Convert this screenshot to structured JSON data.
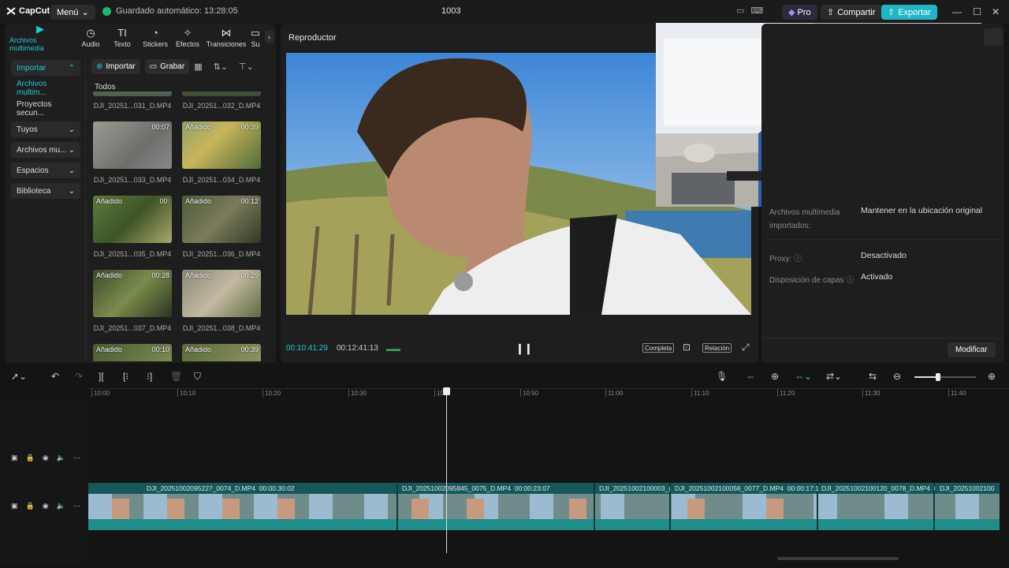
{
  "app": {
    "logo": "CapCut",
    "menu_label": "Menú",
    "autosave": "Guardado automático: 13:28:05",
    "project_title": "1003",
    "pro_label": "Pro",
    "share_label": "Compartir",
    "export_label": "Exportar"
  },
  "tabs": [
    {
      "label": "Archivos multimedia",
      "icon": "media-icon"
    },
    {
      "label": "Audio",
      "icon": "audio-icon"
    },
    {
      "label": "Texto",
      "icon": "text-icon"
    },
    {
      "label": "Stickers",
      "icon": "sticker-icon"
    },
    {
      "label": "Efectos",
      "icon": "effects-icon"
    },
    {
      "label": "Transiciones",
      "icon": "transition-icon"
    },
    {
      "label": "Su",
      "icon": "subtitle-icon"
    }
  ],
  "sidebar": {
    "items": [
      {
        "label": "Importar"
      },
      {
        "label": "Archivos multim..."
      },
      {
        "label": "Proyectos secun..."
      },
      {
        "label": "Tuyos"
      },
      {
        "label": "Archivos mu..."
      },
      {
        "label": "Espacios"
      },
      {
        "label": "Biblioteca"
      }
    ]
  },
  "media": {
    "import_label": "Importar",
    "record_label": "Grabar",
    "filter_all": "Todos",
    "files": [
      {
        "name": "DJI_20251...031_D.MP4",
        "duration": "",
        "added": ""
      },
      {
        "name": "DJI_20251...032_D.MP4",
        "duration": "",
        "added": ""
      },
      {
        "name": "DJI_20251...033_D.MP4",
        "duration": "00:07",
        "added": ""
      },
      {
        "name": "DJI_20251...034_D.MP4",
        "duration": "00:39",
        "added": "Añadido"
      },
      {
        "name": "DJI_20251...035_D.MP4",
        "duration": "00:",
        "added": "Añadido"
      },
      {
        "name": "DJI_20251...036_D.MP4",
        "duration": "00:12",
        "added": "Añadido"
      },
      {
        "name": "DJI_20251...037_D.MP4",
        "duration": "00:28",
        "added": "Añadido"
      },
      {
        "name": "DJI_20251...038_D.MP4",
        "duration": "00:29",
        "added": "Añadido"
      },
      {
        "name": "",
        "duration": "00:10",
        "added": "Añadido"
      },
      {
        "name": "",
        "duration": "00:39",
        "added": "Añadido"
      }
    ]
  },
  "player": {
    "title": "Reproductor",
    "current_time": "00:10:41:29",
    "total_time": "00:12:41:13",
    "full_label": "Completa",
    "ratio_label": "Relación"
  },
  "properties": {
    "rows": [
      {
        "label": "Archivos multimedia importados:",
        "value": "Mantener en la ubicación original"
      },
      {
        "label": "Proxy:",
        "value": "Desactivado"
      },
      {
        "label": "Disposición de capas",
        "value": "Activado"
      }
    ],
    "modify_label": "Modificar"
  },
  "timeline": {
    "ticks": [
      "10:00",
      "10:10",
      "10:20",
      "10:30",
      "10:",
      "10:50",
      "11:00",
      "11:10",
      "11:20",
      "11:30",
      "11:40"
    ],
    "clips": [
      {
        "name": "DJI_20251002095227_0074_D.MP4",
        "duration": "00:00:30:02"
      },
      {
        "name": "DJI_20251002095845_0075_D.MP4",
        "duration": "00:00:23:07"
      },
      {
        "name": "DJI_20251002100003_(",
        "duration": ""
      },
      {
        "name": "DJI_20251002100056_0077_D.MP4",
        "duration": "00:00:17:1"
      },
      {
        "name": "DJI_20251002100120_0078_D.MP4",
        "duration": "0"
      },
      {
        "name": "DJI_20251002100",
        "duration": ""
      }
    ]
  },
  "colors": {
    "accent": "#1fc8d8",
    "export": "#1fb6c9",
    "clip": "#16585a"
  }
}
